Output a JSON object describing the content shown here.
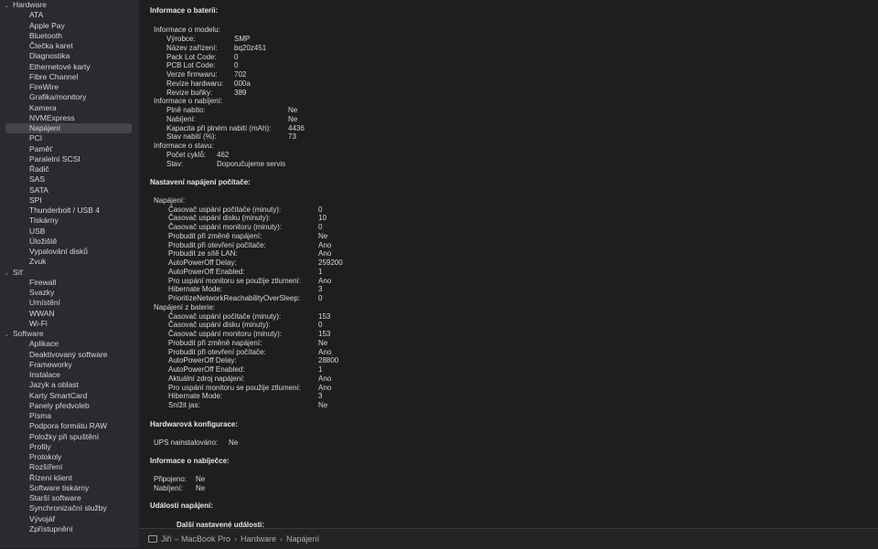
{
  "sidebar": {
    "groups": [
      {
        "label": "Hardware",
        "items": [
          "ATA",
          "Apple Pay",
          "Bluetooth",
          "Čtečka karet",
          "Diagnostika",
          "Ethernetové karty",
          "Fibre Channel",
          "FireWire",
          "Grafika/monitory",
          "Kamera",
          "NVMExpress",
          "Napájení",
          "PCI",
          "Paměť",
          "Paralelní SCSI",
          "Řadič",
          "SAS",
          "SATA",
          "SPI",
          "Thunderbolt / USB 4",
          "Tiskárny",
          "USB",
          "Úložiště",
          "Vypalování disků",
          "Zvuk"
        ]
      },
      {
        "label": "Síť",
        "items": [
          "Firewall",
          "Svazky",
          "Umístění",
          "WWAN",
          "Wi-Fi"
        ]
      },
      {
        "label": "Software",
        "items": [
          "Aplikace",
          "Deaktivovaný software",
          "Frameworky",
          "Instalace",
          "Jazyk a oblast",
          "Karty SmartCard",
          "Panely předvoleb",
          "Písma",
          "Podpora formátu RAW",
          "Položky při spuštění",
          "Profily",
          "Protokoly",
          "Rozšíření",
          "Řízení klient",
          "Software tiskárny",
          "Starší software",
          "Synchronizační služby",
          "Vývojář",
          "Zpřístupnění"
        ]
      }
    ],
    "selected": "Napájení"
  },
  "battery": {
    "title": "Informace o baterii:",
    "model_header": "Informace o modelu:",
    "model": [
      [
        "Výrobce:",
        "SMP"
      ],
      [
        "Název zařízení:",
        "bq20z451"
      ],
      [
        "Pack Lot Code:",
        "0"
      ],
      [
        "PCB Lot Code:",
        "0"
      ],
      [
        "Verze firmwaru:",
        "702"
      ],
      [
        "Revize hardwaru:",
        "000a"
      ],
      [
        "Revize buňky:",
        "389"
      ]
    ],
    "charge_header": "Informace o nabíjení:",
    "charge": [
      [
        "Plně nabito:",
        "Ne"
      ],
      [
        "Nabíjení:",
        "Ne"
      ],
      [
        "Kapacita při plném nabití (mAh):",
        "4436"
      ],
      [
        "Stav nabití (%):",
        "73"
      ]
    ],
    "state_header": "Informace o stavu:",
    "state": [
      [
        "Počet cyklů:",
        "462"
      ],
      [
        "Stav:",
        "Doporučujeme servis"
      ]
    ]
  },
  "power": {
    "title": "Nastavení napájení počítače:",
    "ac_header": "Napájení:",
    "ac": [
      [
        "Časovač uspání počítače (minuty):",
        "0"
      ],
      [
        "Časovač uspání disku (minuty):",
        "10"
      ],
      [
        "Časovač uspání monitoru (minuty):",
        "0"
      ],
      [
        "Probudit při změně napájení:",
        "Ne"
      ],
      [
        "Probudit při otevření počítače:",
        "Ano"
      ],
      [
        "Probudit ze sítě LAN:",
        "Ano"
      ],
      [
        "AutoPowerOff Delay:",
        "259200"
      ],
      [
        "AutoPowerOff Enabled:",
        "1"
      ],
      [
        "Pro uspání monitoru se použije ztlumení:",
        "Ano"
      ],
      [
        "Hibernate Mode:",
        "3"
      ],
      [
        "PrioritizeNetworkReachabilityOverSleep:",
        "0"
      ]
    ],
    "battery_header": "Napájení z baterie:",
    "battery": [
      [
        "Časovač uspání počítače (minuty):",
        "153"
      ],
      [
        "Časovač uspání disku (minuty):",
        "0"
      ],
      [
        "Časovač uspání monitoru (minuty):",
        "153"
      ],
      [
        "Probudit při změně napájení:",
        "Ne"
      ],
      [
        "Probudit při otevření počítače:",
        "Ano"
      ],
      [
        "AutoPowerOff Delay:",
        "28800"
      ],
      [
        "AutoPowerOff Enabled:",
        "1"
      ],
      [
        "Aktuální zdroj napájení:",
        "Ano"
      ],
      [
        "Pro uspání monitoru se použije ztlumení:",
        "Ano"
      ],
      [
        "Hibernate Mode:",
        "3"
      ],
      [
        "Snížit jas:",
        "Ne"
      ]
    ]
  },
  "hardware_config": {
    "title": "Hardwarová konfigurace:",
    "ups_label": "UPS nainstalováno:",
    "ups_value": "Ne"
  },
  "charger": {
    "title": "Informace o nabíječce:",
    "rows": [
      [
        "Připojeno:",
        "Ne"
      ],
      [
        "Nabíjení:",
        "Ne"
      ]
    ]
  },
  "events": {
    "title": "Události napájení:",
    "next_label": "Další nastavené události:"
  },
  "statusbar": {
    "computer": "Jiří – MacBook Pro",
    "sep": "›",
    "crumb1": "Hardware",
    "crumb2": "Napájení"
  }
}
